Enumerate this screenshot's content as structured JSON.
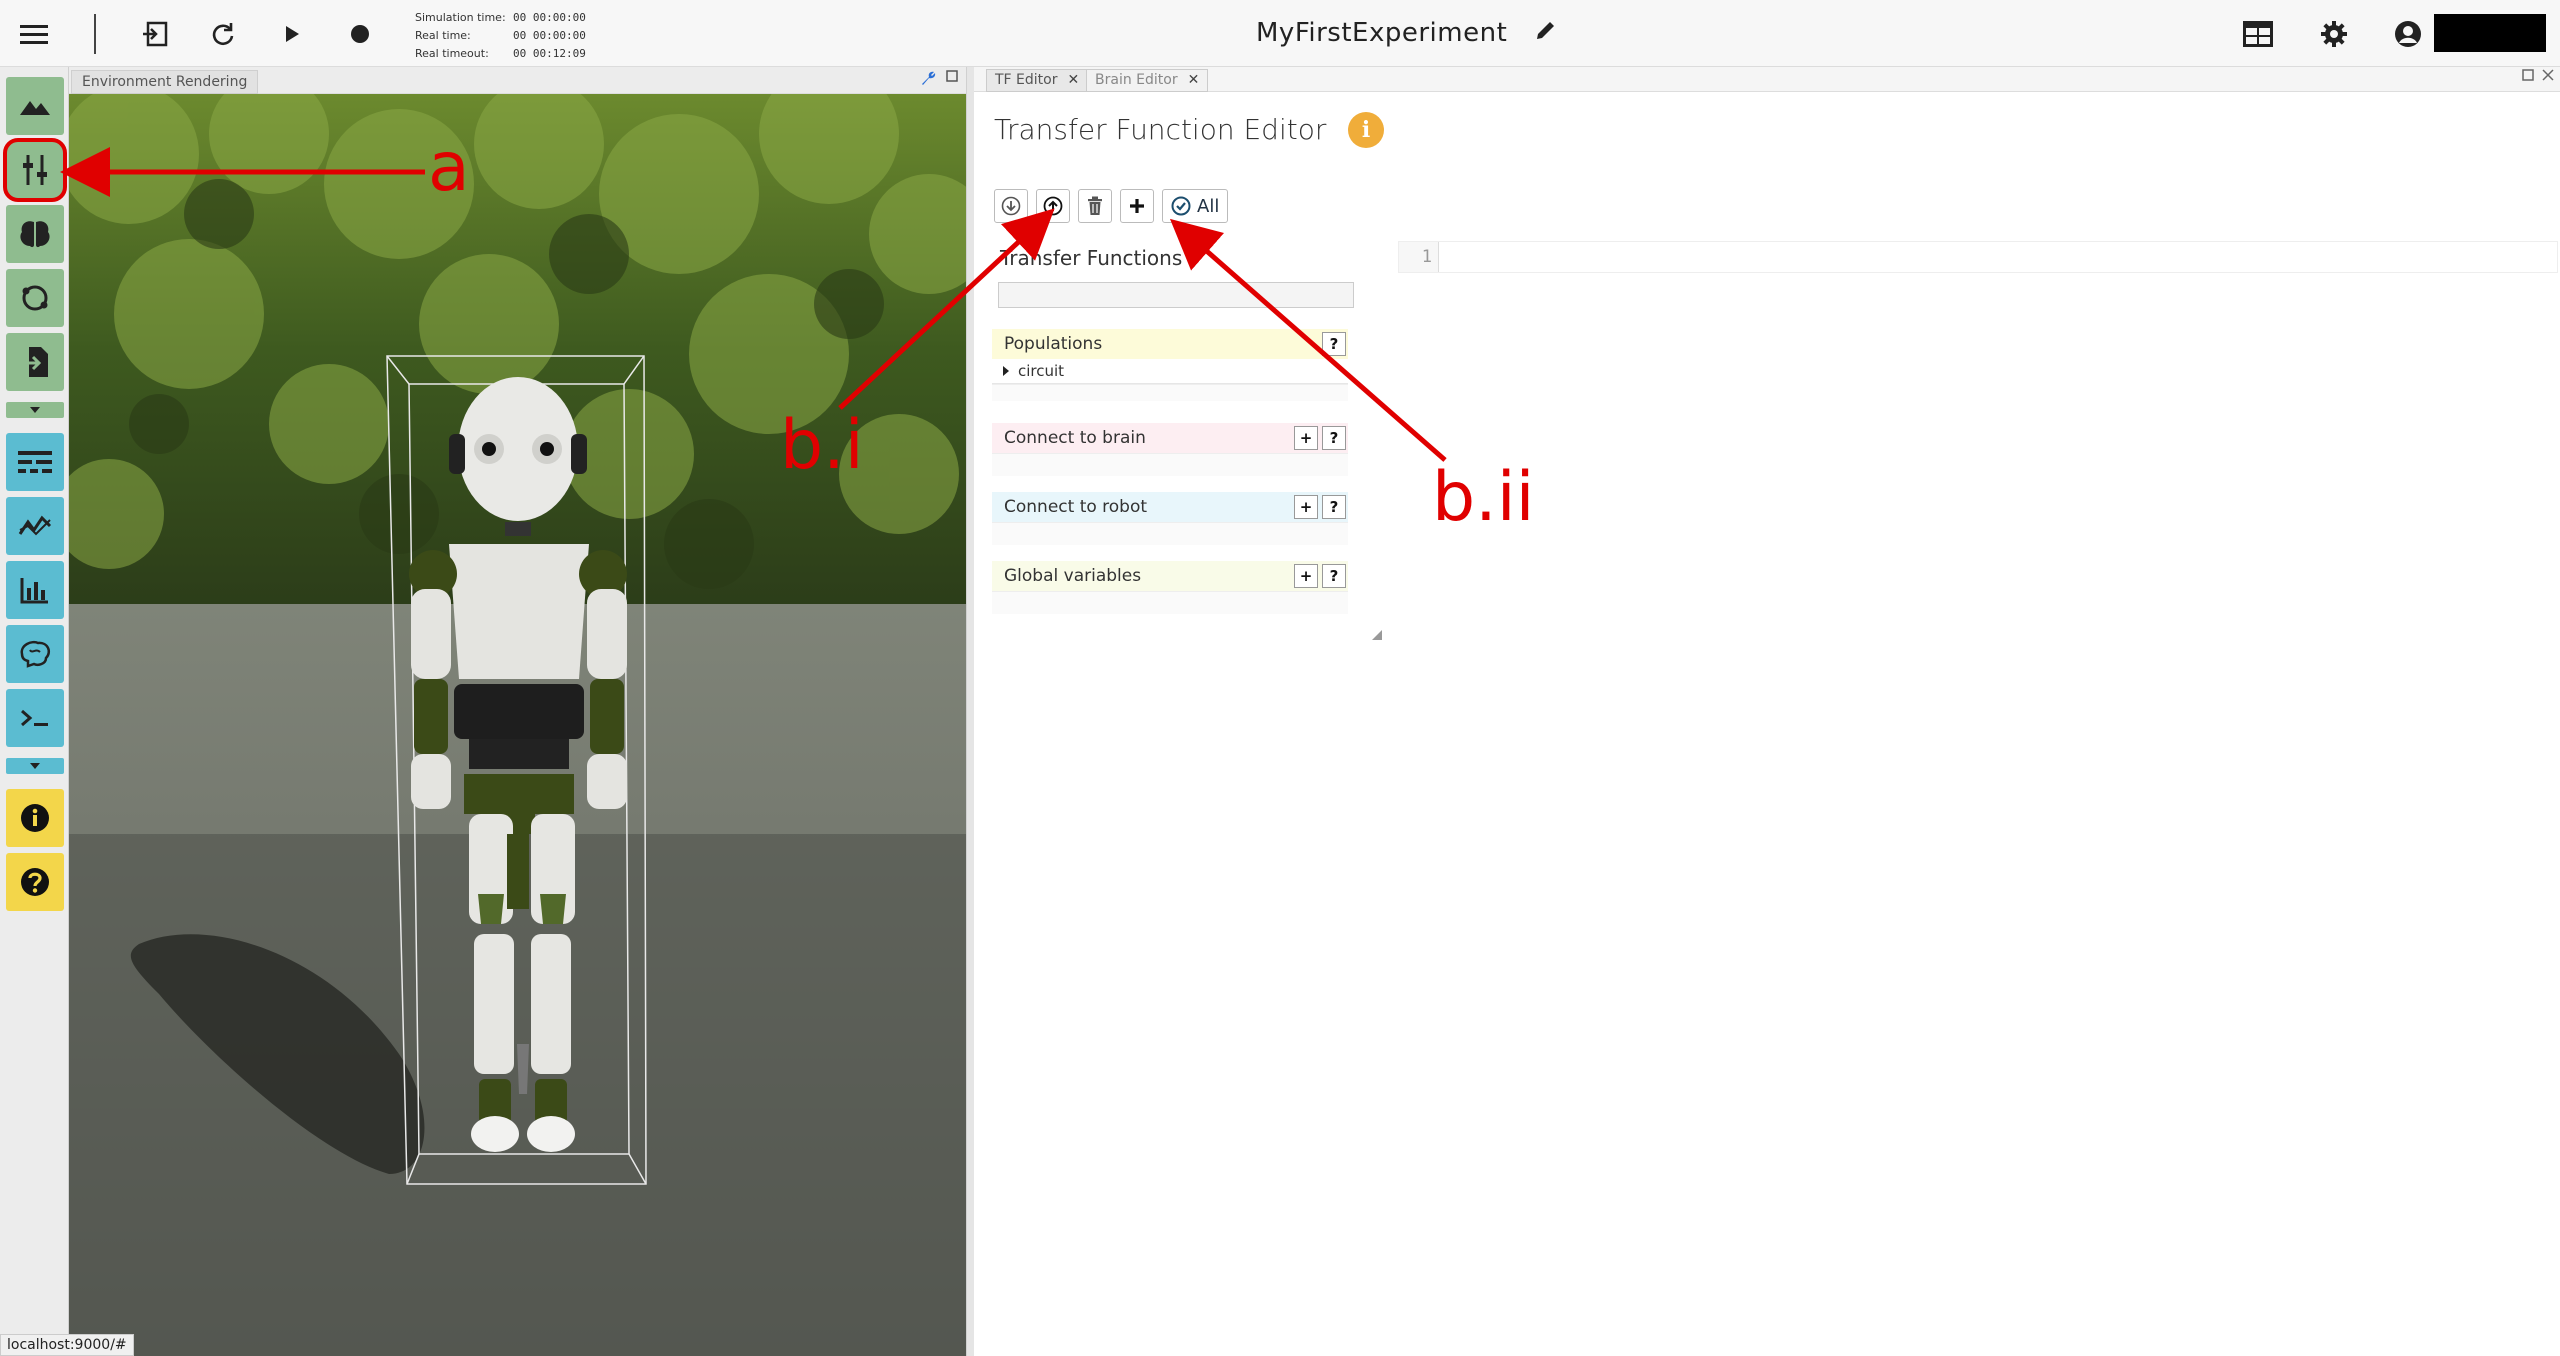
{
  "topbar": {
    "sim_time_label": "Simulation time:",
    "sim_time_value": "00 00:00:00",
    "real_time_label": "Real time:",
    "real_time_value": "00 00:00:00",
    "real_timeout_label": "Real timeout:",
    "real_timeout_value": "00 00:12:09",
    "experiment_title": "MyFirstExperiment"
  },
  "env_pane": {
    "tab_label": "Environment Rendering"
  },
  "tabs": [
    {
      "label": "TF Editor"
    },
    {
      "label": "Brain Editor"
    }
  ],
  "tf_editor": {
    "title": "Transfer Function Editor",
    "info_glyph": "i",
    "all_label": "All",
    "list_title": "Transfer Functions",
    "sections": {
      "populations": {
        "title": "Populations",
        "item": "circuit"
      },
      "connect_brain": {
        "title": "Connect to brain"
      },
      "connect_robot": {
        "title": "Connect to robot"
      },
      "globals": {
        "title": "Global variables"
      }
    },
    "help_glyph": "?",
    "add_glyph": "+"
  },
  "code_editor": {
    "line_number": "1"
  },
  "status_bar": {
    "url": "localhost:9000/#"
  },
  "annotations": {
    "a": "a",
    "bi": "b.i",
    "bii": "b.ii",
    "color": "#e00000"
  },
  "colors": {
    "sidebar_green": "#8fbc8f",
    "sidebar_cyan": "#5bbcd1",
    "sidebar_yellow": "#f3d64a",
    "info_orange": "#f0ad3a"
  }
}
